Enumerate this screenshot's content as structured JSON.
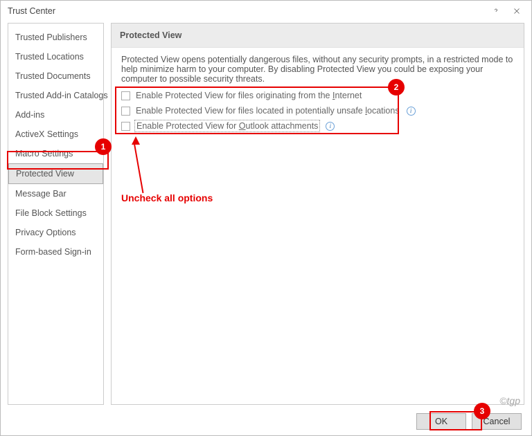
{
  "dialog": {
    "title": "Trust Center"
  },
  "sidebar": {
    "items": [
      {
        "label": "Trusted Publishers"
      },
      {
        "label": "Trusted Locations"
      },
      {
        "label": "Trusted Documents"
      },
      {
        "label": "Trusted Add-in Catalogs"
      },
      {
        "label": "Add-ins"
      },
      {
        "label": "ActiveX Settings"
      },
      {
        "label": "Macro Settings"
      },
      {
        "label": "Protected View",
        "selected": true
      },
      {
        "label": "Message Bar"
      },
      {
        "label": "File Block Settings"
      },
      {
        "label": "Privacy Options"
      },
      {
        "label": "Form-based Sign-in"
      }
    ]
  },
  "main": {
    "section_header": "Protected View",
    "description": "Protected View opens potentially dangerous files, without any security prompts, in a restricted mode to help minimize harm to your computer. By disabling Protected View you could be exposing your computer to possible security threats.",
    "options": [
      {
        "pre": "Enable Protected View for files originating from the ",
        "u": "I",
        "post": "nternet",
        "checked": false,
        "info": false
      },
      {
        "pre": "Enable Protected View for files located in potentially unsafe ",
        "u": "l",
        "post": "ocations",
        "checked": false,
        "info": true
      },
      {
        "pre": "Enable Protected View for ",
        "u": "O",
        "post": "utlook attachments",
        "checked": false,
        "info": true,
        "focused": true
      }
    ]
  },
  "footer": {
    "ok": "OK",
    "cancel": "Cancel"
  },
  "annotations": {
    "label": "Uncheck all options",
    "badges": [
      "1",
      "2",
      "3"
    ]
  },
  "credit": "©tgp"
}
